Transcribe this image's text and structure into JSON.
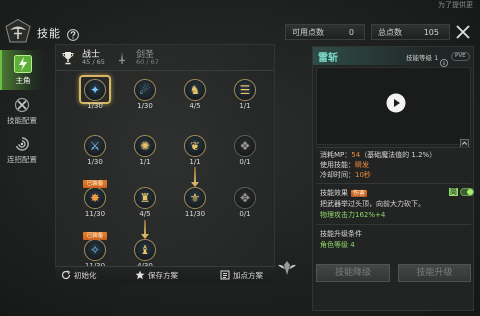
{
  "header": {
    "title": "技能",
    "corner_text": "为了提供更",
    "available_points_label": "可用点数",
    "available_points_value": "0",
    "total_points_label": "总点数",
    "total_points_value": "105"
  },
  "sidebar": {
    "items": [
      {
        "label": "主角",
        "icon": "hero-icon"
      },
      {
        "label": "技能配置",
        "icon": "skill-config-icon"
      },
      {
        "label": "连招配置",
        "icon": "combo-config-icon"
      }
    ]
  },
  "classes": {
    "tabs": [
      {
        "name": "战士",
        "points": "45 / 65",
        "icon": "trophy-icon"
      },
      {
        "name": "剑圣",
        "points": "60 / 67",
        "icon": "sword-icon"
      }
    ]
  },
  "skill_tree": {
    "rows": [
      [
        {
          "level": "1/30",
          "icon": "wind-slash-icon"
        },
        {
          "level": "1/30",
          "icon": "comet-icon"
        },
        {
          "level": "4/5",
          "icon": "knight-icon"
        },
        {
          "level": "1/1",
          "icon": "scroll-icon"
        }
      ],
      [
        {
          "level": "1/30",
          "icon": "crossed-swords-icon"
        },
        {
          "level": "1/1",
          "icon": "burst-icon"
        },
        {
          "level": "1/1",
          "icon": "wings-icon"
        },
        {
          "level": "0/1",
          "icon": "rune-icon"
        }
      ],
      [
        {
          "level": "11/30",
          "badge": "已装备",
          "icon": "whirlwind-icon"
        },
        {
          "level": "4/5",
          "icon": "tower-icon"
        },
        {
          "level": "11/30",
          "icon": "fleur-icon"
        },
        {
          "level": "0/1",
          "icon": "guard-icon"
        }
      ],
      [
        {
          "level": "11/30",
          "badge": "已装备",
          "icon": "sparkle-blade-icon"
        },
        {
          "level": "4/30",
          "icon": "bishop-icon"
        }
      ]
    ]
  },
  "footer": {
    "reset_label": "初始化",
    "save_label": "保存方案",
    "plan_label": "加点方案"
  },
  "detail": {
    "skill_name": "雷斩",
    "skill_level": "技能等级 1",
    "mode_tag": "PVE",
    "mp_cost_label": "消耗MP：",
    "mp_cost_value": "54",
    "mp_cost_note": "（基础魔法值的 1.2%）",
    "cast_label": "使用技能：",
    "cast_value": "瞬发",
    "cooldown_label": "冷却时间：",
    "cooldown_value": "10秒",
    "effect_label": "技能效果",
    "effect_tag": "伤害",
    "toggle_label": "简",
    "description": "把武器举过头顶，向前大力砍下。",
    "damage": "物理攻击力162%+4",
    "upgrade_req_label": "技能升级条件",
    "upgrade_req_value": "角色等级 4",
    "downgrade_button": "技能降级",
    "upgrade_button": "技能升级"
  },
  "colors": {
    "gold": "#d6b563",
    "teal": "#7fe0cd",
    "orange": "#ee8a3a",
    "green": "#93d86b",
    "badge": "#c8621f",
    "active_green": "#6cc043"
  }
}
